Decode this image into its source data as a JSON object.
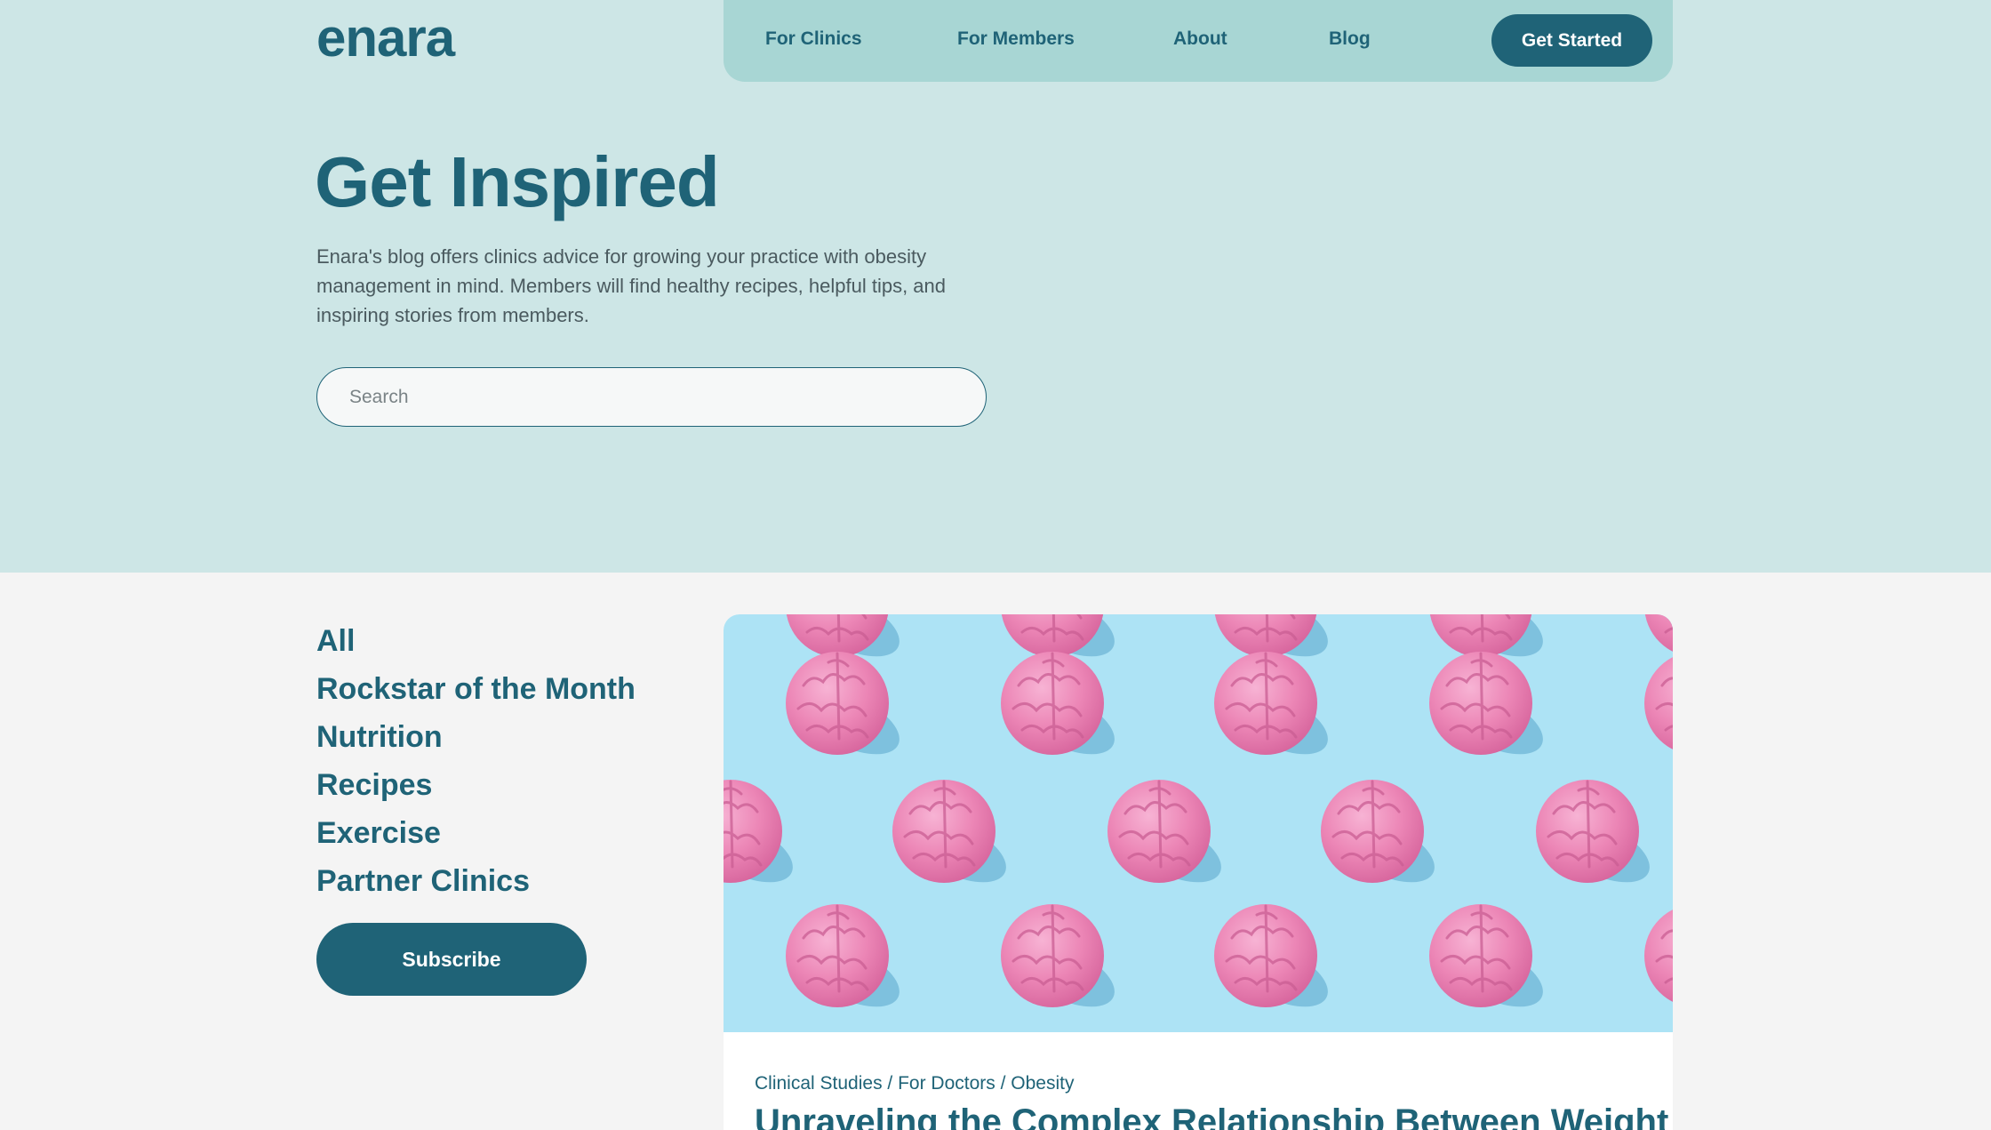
{
  "brand": {
    "logo_text": "enara",
    "primary_color": "#1f6377",
    "hero_bg": "#cde6e6",
    "nav_bg": "#a8d6d4"
  },
  "nav": {
    "links": [
      "For Clinics",
      "For Members",
      "About",
      "Blog"
    ],
    "cta_label": "Get Started"
  },
  "hero": {
    "title": "Get Inspired",
    "description": "Enara's blog offers clinics advice for growing your practice with obesity management in mind. Members will find healthy recipes, helpful tips, and inspiring stories from members.",
    "search_placeholder": "Search"
  },
  "categories": [
    "All",
    "Rockstar of the Month",
    "Nutrition",
    "Recipes",
    "Exercise",
    "Partner Clinics"
  ],
  "subscribe_label": "Subscribe",
  "featured_post": {
    "image": {
      "icon": "pink-brains-pattern",
      "background_color": "#ade3f5"
    },
    "tags": "Clinical Studies / For Doctors / Obesity",
    "title": "Unraveling the Complex Relationship Between Weight"
  }
}
